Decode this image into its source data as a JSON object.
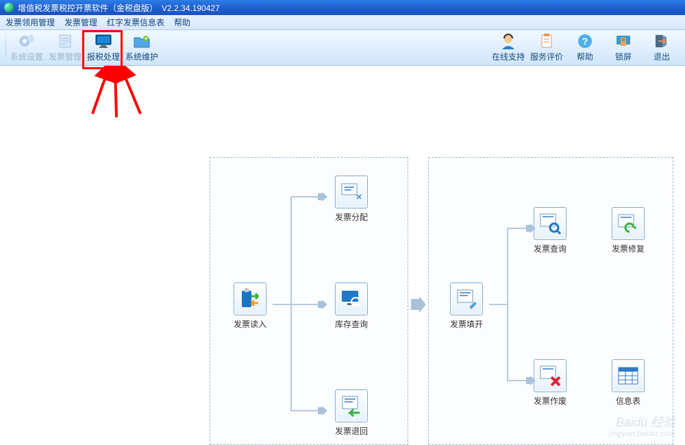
{
  "title": "增值税发票税控开票软件（金税盘版）　V2.2.34.190427",
  "menu": {
    "m1": "发票领用管理",
    "m2": "发票管理",
    "m3": "红字发票信息表",
    "m4": "帮助"
  },
  "toolbar": {
    "sys_settings": "系统设置",
    "invoice_mgmt": "发票管理",
    "tax_report": "报税处理",
    "sys_maint": "系统维护",
    "online_support": "在线支持",
    "service_eval": "服务评价",
    "help": "帮助",
    "lock": "锁屏",
    "exit": "退出"
  },
  "nodes": {
    "read": "发票读入",
    "allocate": "发票分配",
    "stock_q": "库存查询",
    "ret": "发票退回",
    "fill": "发票填开",
    "query": "发票查询",
    "repair": "发票修复",
    "void": "发票作废",
    "info": "信息表"
  },
  "watermark": {
    "main": "Baidu 经验",
    "sub": "jingyan.baidu.com"
  }
}
